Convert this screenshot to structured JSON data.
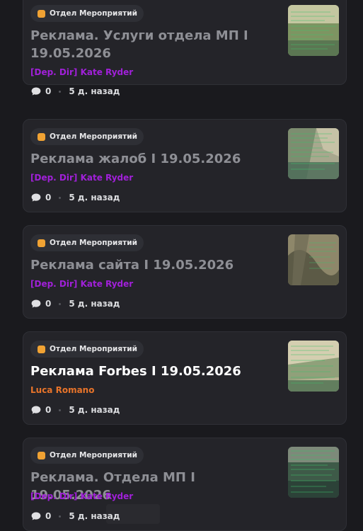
{
  "posts": [
    {
      "tag": "Отдел Мероприятий",
      "title": "Реклама. Услуги отдела МП I 19.05.2026",
      "author": "[Dep. Dir] Kate Ryder",
      "author_color": "#a020d8",
      "comments": "0",
      "time": "5 д. назад",
      "unread": false,
      "thumb_colors": [
        "#b8bf94",
        "#6f8a55",
        "#4a6b4a"
      ]
    },
    {
      "tag": "Отдел Мероприятий",
      "title": "Реклама жалоб I 19.05.2026",
      "author": "[Dep. Dir] Kate Ryder",
      "author_color": "#a020d8",
      "comments": "0",
      "time": "5 д. назад",
      "unread": false,
      "thumb_colors": [
        "#c4c2a8",
        "#7f8f72",
        "#3f6150"
      ]
    },
    {
      "tag": "Отдел Мероприятий",
      "title": "Реклама сайта I 19.05.2026",
      "author": "[Dep. Dir] Kate Ryder",
      "author_color": "#a020d8",
      "comments": "0",
      "time": "5 д. назад",
      "unread": false,
      "thumb_colors": [
        "#9b9472",
        "#6e6a52",
        "#4b5a48"
      ]
    },
    {
      "tag": "Отдел Мероприятий",
      "title": "Реклама Forbes I 19.05.2026",
      "author": "Luca Romano",
      "author_color": "#e8742a",
      "comments": "0",
      "time": "5 д. назад",
      "unread": true,
      "thumb_colors": [
        "#cfc7a4",
        "#8f9a78",
        "#5d7a5c"
      ]
    },
    {
      "tag": "Отдел Мероприятий",
      "title": "Реклама. Отдела МП I 19.05.2026",
      "author": "[Dep. Dir] Kate Ryder",
      "author_color": "#a020d8",
      "comments": "0",
      "time": "5 д. назад",
      "unread": false,
      "thumb_colors": [
        "#6c7a6a",
        "#3c5a48",
        "#2a3f38"
      ]
    }
  ],
  "icons": {
    "tag": "square-icon",
    "comments": "speech-bubble-icon"
  },
  "colors": {
    "tag_icon": "#f0a233",
    "title_read": "#8e8f95",
    "title_unread": "#ffffff",
    "card_bg": "#242429",
    "page_bg": "#1a1a1e"
  }
}
